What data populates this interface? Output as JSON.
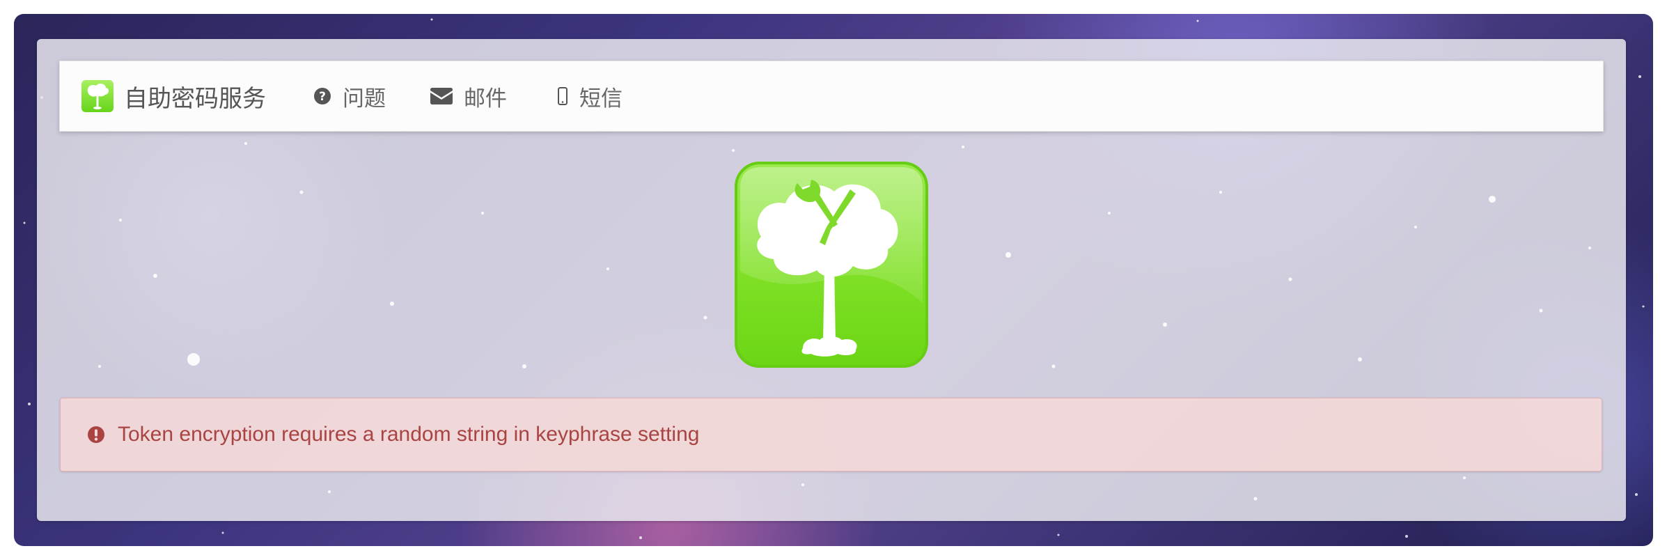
{
  "navbar": {
    "brand": {
      "label": "自助密码服务",
      "icon": "tree-logo-icon"
    },
    "items": [
      {
        "label": "问题",
        "icon": "question-circle-icon"
      },
      {
        "label": "邮件",
        "icon": "envelope-icon"
      },
      {
        "label": "短信",
        "icon": "mobile-phone-icon"
      }
    ]
  },
  "logo": {
    "icon": "tree-wrench-logo-icon"
  },
  "alert": {
    "type": "error",
    "icon": "exclamation-circle-icon",
    "message": "Token encryption requires a random string in keyphrase setting"
  },
  "colors": {
    "accent_green": "#7ad82b",
    "alert_text": "#a94442",
    "alert_background": "#f2d8d8",
    "nav_text": "#666666"
  }
}
